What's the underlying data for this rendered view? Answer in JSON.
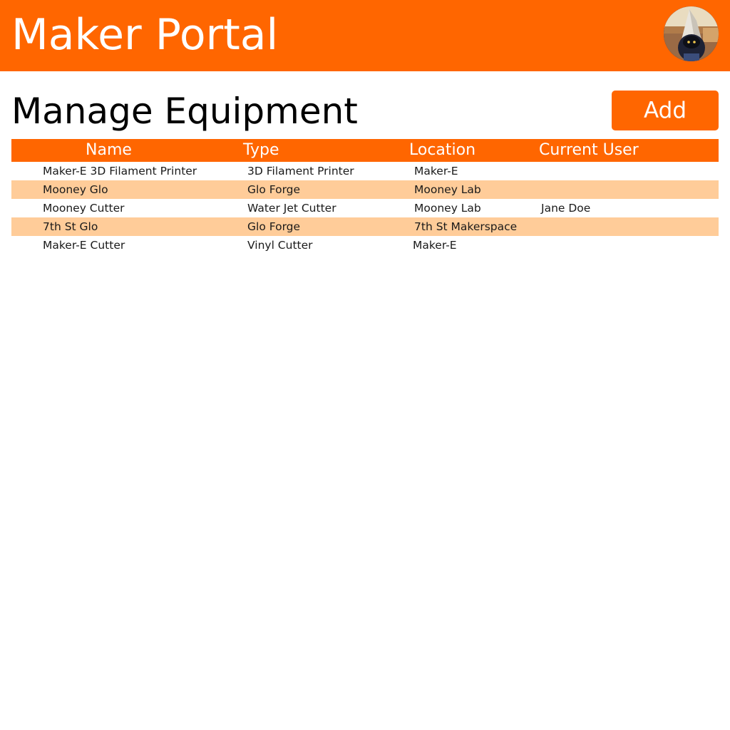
{
  "header": {
    "title": "Maker Portal",
    "avatar_icon": "user-avatar-icon",
    "brand_color": "#ff6600"
  },
  "main": {
    "page_title": "Manage Equipment",
    "add_label": "Add"
  },
  "table": {
    "columns": [
      "Name",
      "Type",
      "Location",
      "Current User"
    ],
    "rows": [
      [
        "Maker-E 3D Filament Printer",
        "3D Filament Printer",
        "Maker-E",
        ""
      ],
      [
        "Mooney Glo",
        "Glo Forge",
        "Mooney Lab",
        ""
      ],
      [
        "Mooney Cutter",
        "Water Jet Cutter",
        "Mooney Lab",
        "Jane Doe"
      ],
      [
        "7th St Glo",
        "Glo Forge",
        "7th St Makerspace",
        ""
      ],
      [
        "Maker-E Cutter",
        "Vinyl Cutter",
        "Maker-E",
        ""
      ]
    ],
    "header_color": "#ff6600",
    "stripe_color": "#ffcc99"
  }
}
